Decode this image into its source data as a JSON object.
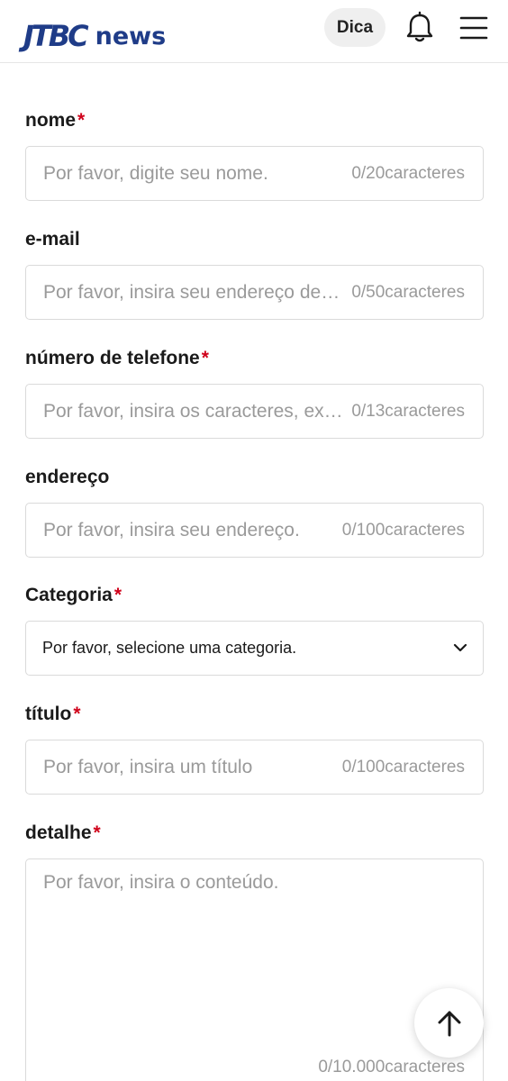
{
  "header": {
    "logo_mark": "JTBC",
    "logo_text": "news",
    "dica_label": "Dica",
    "bell_icon": "bell-icon",
    "menu_icon": "hamburger-menu-icon",
    "brand_color": "#1f3c88"
  },
  "form": {
    "required_mark": "*",
    "required_color": "#d0021b",
    "name": {
      "label": "nome",
      "placeholder": "Por favor, digite seu nome.",
      "counter": "0/20caracteres"
    },
    "email": {
      "label": "e-mail",
      "placeholder": "Por favor, insira seu endereço de e-mail.",
      "counter": "0/50caracteres"
    },
    "phone": {
      "label": "número de telefone",
      "placeholder": "Por favor, insira os caracteres, exceto",
      "counter": "0/13caracteres"
    },
    "address": {
      "label": "endereço",
      "placeholder": "Por favor, insira seu endereço.",
      "counter": "0/100caracteres"
    },
    "category": {
      "label": "Categoria",
      "selected": "Por favor, selecione uma categoria.",
      "chevron_icon": "chevron-down-icon"
    },
    "title": {
      "label": "título",
      "placeholder": "Por favor, insira um título",
      "counter": "0/100caracteres"
    },
    "detail": {
      "label": "detalhe",
      "placeholder": "Por favor, insira o conteúdo.",
      "counter": "0/10.000caracteres"
    }
  },
  "scroll_top": {
    "icon": "arrow-up-icon"
  }
}
